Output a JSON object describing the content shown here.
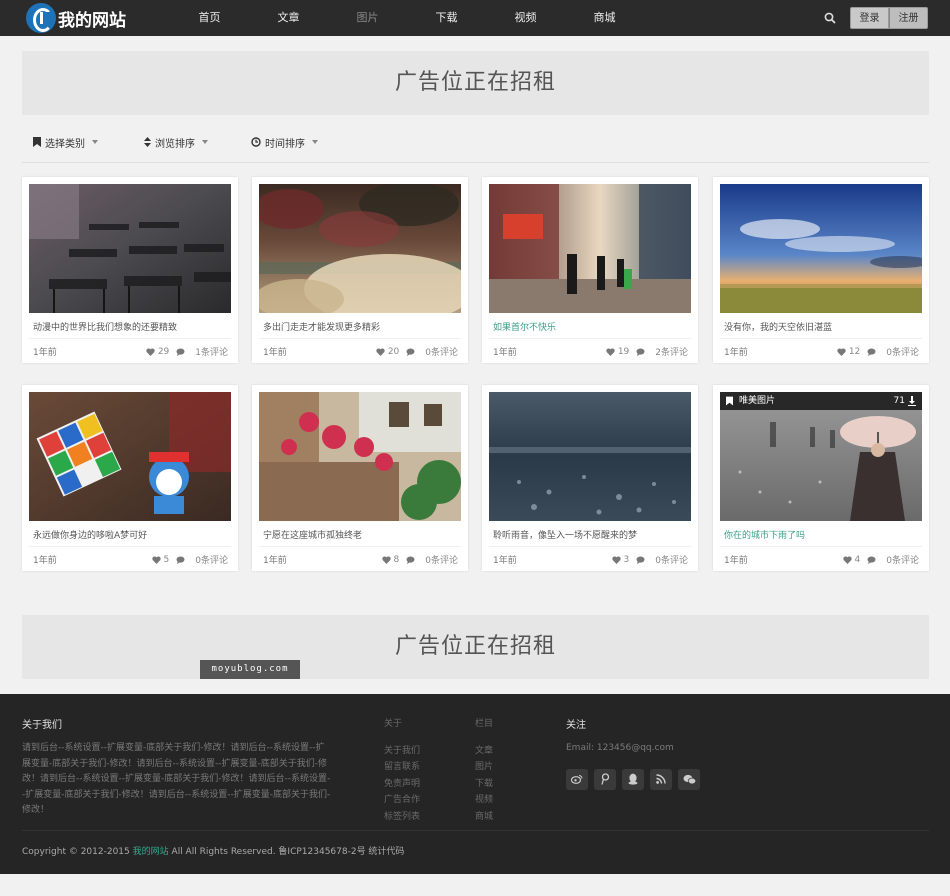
{
  "header": {
    "site_name": "我的网站",
    "nav": [
      "首页",
      "文章",
      "图片",
      "下载",
      "视频",
      "商城"
    ],
    "active_nav": "图片",
    "login": "登录",
    "register": "注册"
  },
  "ads": {
    "top": "广告位正在招租",
    "bottom": "广告位正在招租"
  },
  "filters": {
    "category": "选择类别",
    "views": "浏览排序",
    "time": "时间排序"
  },
  "cards": [
    {
      "title": "动漫中的世界比我们想象的还要精致",
      "time": "1年前",
      "likes": "29",
      "comments": "1条评论"
    },
    {
      "title": "多出门走走才能发现更多精彩",
      "time": "1年前",
      "likes": "20",
      "comments": "0条评论"
    },
    {
      "title": "如果首尔不快乐",
      "time": "1年前",
      "likes": "19",
      "comments": "2条评论"
    },
    {
      "title": "没有你，我的天空依旧湛蓝",
      "time": "1年前",
      "likes": "12",
      "comments": "0条评论"
    },
    {
      "title": "永远做你身边的哆啦A梦可好",
      "time": "1年前",
      "likes": "5",
      "comments": "0条评论"
    },
    {
      "title": "宁愿在这座城市孤独终老",
      "time": "1年前",
      "likes": "8",
      "comments": "0条评论"
    },
    {
      "title": "聆听雨音，像坠入一场不愿醒来的梦",
      "time": "1年前",
      "likes": "3",
      "comments": "0条评论"
    },
    {
      "title": "你在的城市下雨了吗",
      "time": "1年前",
      "likes": "4",
      "comments": "0条评论",
      "tag": "唯美图片",
      "tag_count": "71"
    }
  ],
  "watermark": "moyublog.com",
  "footer": {
    "about_title": "关于我们",
    "about_text": "请到后台--系统设置--扩展变量-底部关于我们-修改！请到后台--系统设置--扩展变量-底部关于我们-修改！请到后台--系统设置--扩展变量-底部关于我们-修改！请到后台--系统设置--扩展变量-底部关于我们-修改！请到后台--系统设置--扩展变量-底部关于我们-修改！请到后台--系统设置--扩展变量-底部关于我们-修改！",
    "links_title": "关于",
    "links": [
      "关于我们",
      "留言联系",
      "免责声明",
      "广告合作",
      "标签列表"
    ],
    "columns_title": "栏目",
    "columns": [
      "文章",
      "图片",
      "下载",
      "视频",
      "商城"
    ],
    "follow_title": "关注",
    "email": "Email: 123456@qq.com",
    "social": [
      "weibo-icon",
      "tencent-weibo-icon",
      "qq-icon",
      "rss-icon",
      "wechat-icon"
    ],
    "copyright_prefix": "Copyright © 2012-2015",
    "copyright_brand": "我的网站",
    "copyright_suffix": "All All Rights Reserved. 鲁ICP12345678-2号 统计代码"
  }
}
